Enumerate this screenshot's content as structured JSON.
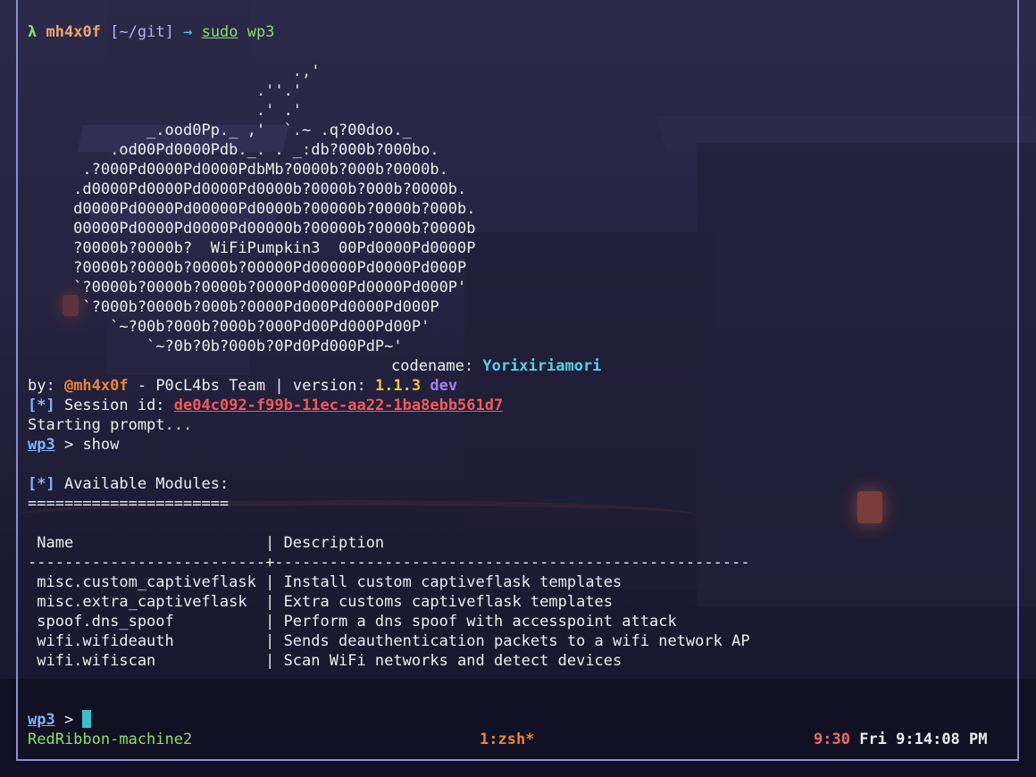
{
  "colors": {
    "frame": "#8d8ad6",
    "text": "#ececf3",
    "green": "#8ddc6e",
    "cyan": "#54d3e1",
    "orange": "#e8843d",
    "blue": "#7fb3ff",
    "red": "#ef5a5a",
    "purple": "#a97cf2",
    "yellow": "#e8c547"
  },
  "shell_prompt": {
    "lambda": "λ",
    "user": "mh4x0f",
    "path": "[~/git]",
    "arrow": "→",
    "command": "sudo",
    "argument": "wp3"
  },
  "banner": [
    "                             .,'",
    "                         .''.'",
    "                         .' .'",
    "                         :  :'",
    "             _.ood0Pp._ ,'  `.~ .q?00doo._",
    "         .od00Pd0000Pdb._. . _:db?000b?000bo.",
    "      .?000Pd0000Pd0000PdbMb?0000b?000b?0000b.",
    "     .d0000Pd0000Pd0000Pd0000b?0000b?000b?0000b.",
    "     d0000Pd0000Pd00000Pd0000b?00000b?0000b?000b.",
    "     00000Pd0000Pd0000Pd00000b?00000b?0000b?0000b",
    "     ?0000b?0000b?  WiFiPumpkin3  00Pd0000Pd0000P",
    "     ?0000b?0000b?0000b?00000Pd00000Pd0000Pd000P",
    "     `?0000b?0000b?0000b?0000Pd0000Pd0000Pd000P'",
    "      `?000b?0000b?000b?0000Pd000Pd0000Pd000P",
    "         `~?00b?000b?000b?000Pd00Pd000Pd00P'",
    "             `~?0b?0b?000b?0Pd0Pd000PdP~'"
  ],
  "codename": {
    "label": "codename: ",
    "value": "Yorixiriamori"
  },
  "byline": {
    "prefix": "by: ",
    "author": "@mh4x0f",
    "team": " - P0cL4bs Team | version: ",
    "version": "1.1.3",
    "tag": "dev"
  },
  "session": {
    "marker": "[*]",
    "label": " Session id: ",
    "id": "de04c092-f99b-11ec-aa22-1ba8ebb561d7"
  },
  "starting": "Starting prompt...",
  "prompt": {
    "name": "wp3",
    "separator": " > ",
    "command": "show"
  },
  "modules": {
    "marker": "[*]",
    "title": " Available Modules:",
    "underline": "======================",
    "header": " Name                     | Description",
    "divider": "--------------------------+----------------------------------------------------",
    "rows": [
      " misc.custom_captiveflask | Install custom captiveflask templates",
      " misc.extra_captiveflask  | Extra customs captiveflask templates",
      " spoof.dns_spoof          | Perform a dns spoof with accesspoint attack",
      " wifi.wifideauth          | Sends deauthentication packets to a wifi network AP",
      " wifi.wifiscan            | Scan WiFi networks and detect devices"
    ]
  },
  "final_prompt": {
    "name": "wp3",
    "separator": " > "
  },
  "status_bar": {
    "session": "RedRibbon-machine2",
    "window": "1:zsh*",
    "time": "9:30",
    "date": "Fri 9:14:08 PM"
  }
}
